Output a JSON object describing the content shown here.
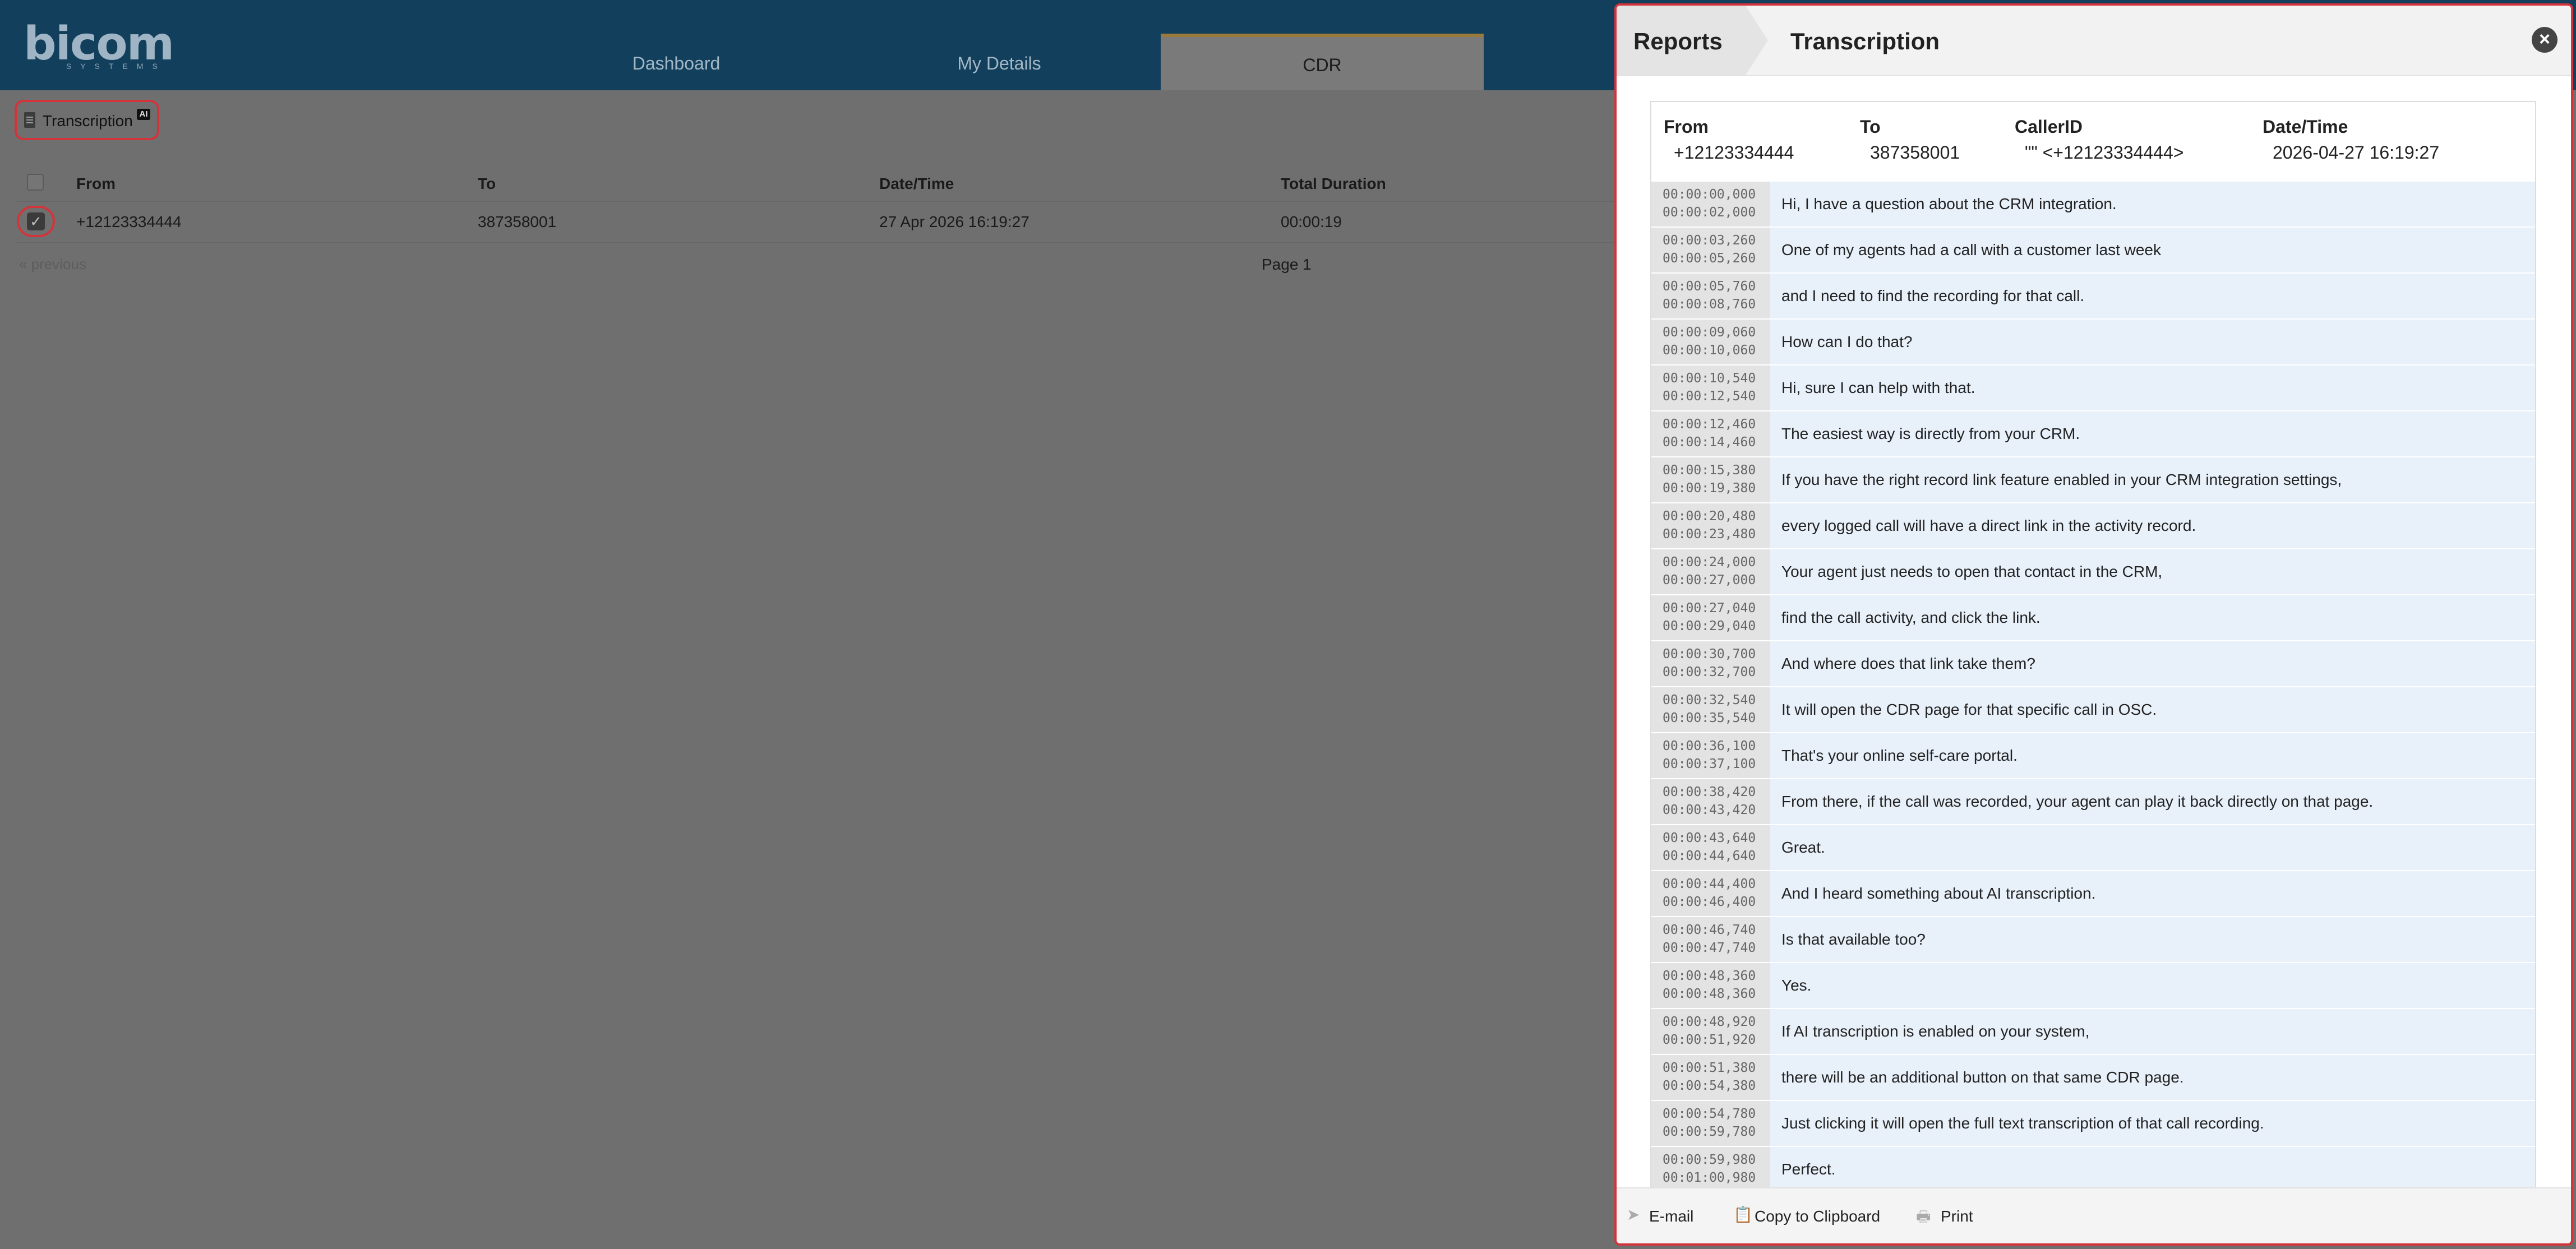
{
  "app": {
    "logo_text": "bicom",
    "logo_sub": "SYSTEMS",
    "nav_tabs": [
      "Dashboard",
      "My Details",
      "CDR"
    ],
    "active_tab": "CDR"
  },
  "toolbar": {
    "transcription_label": "Transcription",
    "ai_badge": "AI"
  },
  "table": {
    "columns": [
      "From",
      "To",
      "Date/Time",
      "Total Duration"
    ],
    "rows": [
      {
        "from": "+12123334444",
        "to": "387358001",
        "datetime": "27 Apr 2026 16:19:27",
        "duration": "00:00:19",
        "checked": true
      }
    ],
    "previous_label": "« previous",
    "page_label": "Page 1"
  },
  "modal": {
    "breadcrumb_parent": "Reports",
    "title": "Transcription",
    "close_symbol": "×",
    "info": {
      "from_label": "From",
      "from_value": "+12123334444",
      "to_label": "To",
      "to_value": "387358001",
      "callerid_label": "CallerID",
      "callerid_value": "\"\" <+12123334444>",
      "datetime_label": "Date/Time",
      "datetime_value": "2026-04-27 16:19:27"
    },
    "transcript": [
      {
        "start": "00:00:00,000",
        "end": "00:00:02,000",
        "text": "Hi, I have a question about the CRM integration."
      },
      {
        "start": "00:00:03,260",
        "end": "00:00:05,260",
        "text": "One of my agents had a call with a customer last week"
      },
      {
        "start": "00:00:05,760",
        "end": "00:00:08,760",
        "text": "and I need to find the recording for that call."
      },
      {
        "start": "00:00:09,060",
        "end": "00:00:10,060",
        "text": "How can I do that?"
      },
      {
        "start": "00:00:10,540",
        "end": "00:00:12,540",
        "text": "Hi, sure I can help with that."
      },
      {
        "start": "00:00:12,460",
        "end": "00:00:14,460",
        "text": "The easiest way is directly from your CRM."
      },
      {
        "start": "00:00:15,380",
        "end": "00:00:19,380",
        "text": "If you have the right record link feature enabled in your CRM integration settings,"
      },
      {
        "start": "00:00:20,480",
        "end": "00:00:23,480",
        "text": "every logged call will have a direct link in the activity record."
      },
      {
        "start": "00:00:24,000",
        "end": "00:00:27,000",
        "text": "Your agent just needs to open that contact in the CRM,"
      },
      {
        "start": "00:00:27,040",
        "end": "00:00:29,040",
        "text": "find the call activity, and click the link."
      },
      {
        "start": "00:00:30,700",
        "end": "00:00:32,700",
        "text": "And where does that link take them?"
      },
      {
        "start": "00:00:32,540",
        "end": "00:00:35,540",
        "text": "It will open the CDR page for that specific call in OSC."
      },
      {
        "start": "00:00:36,100",
        "end": "00:00:37,100",
        "text": "That's your online self-care portal."
      },
      {
        "start": "00:00:38,420",
        "end": "00:00:43,420",
        "text": "From there, if the call was recorded, your agent can play it back directly on that page."
      },
      {
        "start": "00:00:43,640",
        "end": "00:00:44,640",
        "text": "Great."
      },
      {
        "start": "00:00:44,400",
        "end": "00:00:46,400",
        "text": "And I heard something about AI transcription."
      },
      {
        "start": "00:00:46,740",
        "end": "00:00:47,740",
        "text": "Is that available too?"
      },
      {
        "start": "00:00:48,360",
        "end": "00:00:48,360",
        "text": "Yes."
      },
      {
        "start": "00:00:48,920",
        "end": "00:00:51,920",
        "text": "If AI transcription is enabled on your system,"
      },
      {
        "start": "00:00:51,380",
        "end": "00:00:54,380",
        "text": "there will be an additional button on that same CDR page."
      },
      {
        "start": "00:00:54,780",
        "end": "00:00:59,780",
        "text": "Just clicking it will open the full text transcription of that call recording."
      },
      {
        "start": "00:00:59,980",
        "end": "00:01:00,980",
        "text": "Perfect."
      }
    ],
    "footer": {
      "email_label": "E-mail",
      "copy_label": "Copy to Clipboard",
      "print_label": "Print"
    }
  }
}
